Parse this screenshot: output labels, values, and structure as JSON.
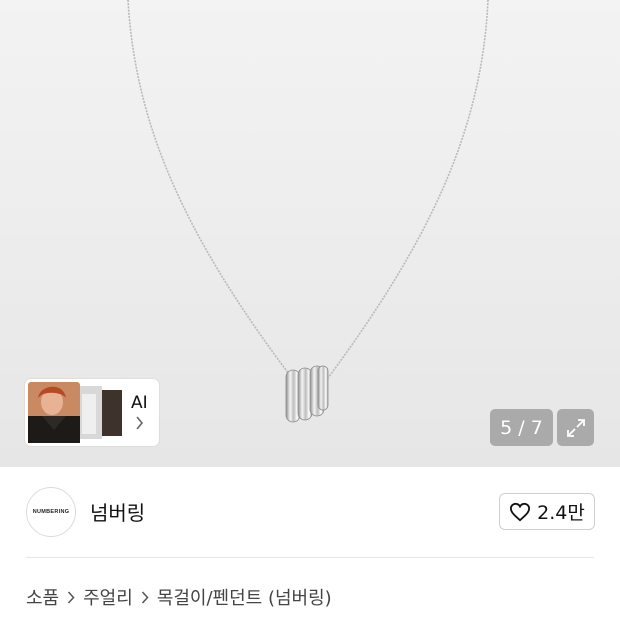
{
  "gallery": {
    "ai_label": "AI",
    "counter": "5 / 7",
    "expand_icon": "expand-arrows-icon"
  },
  "brand": {
    "logo_text": "NUMBERING",
    "name": "넘버링",
    "like_count": "2.4만",
    "like_icon": "heart-outline-icon"
  },
  "breadcrumb": {
    "items": [
      "소품",
      "주얼리",
      "목걸이/펜던트 (넘버링)"
    ]
  }
}
